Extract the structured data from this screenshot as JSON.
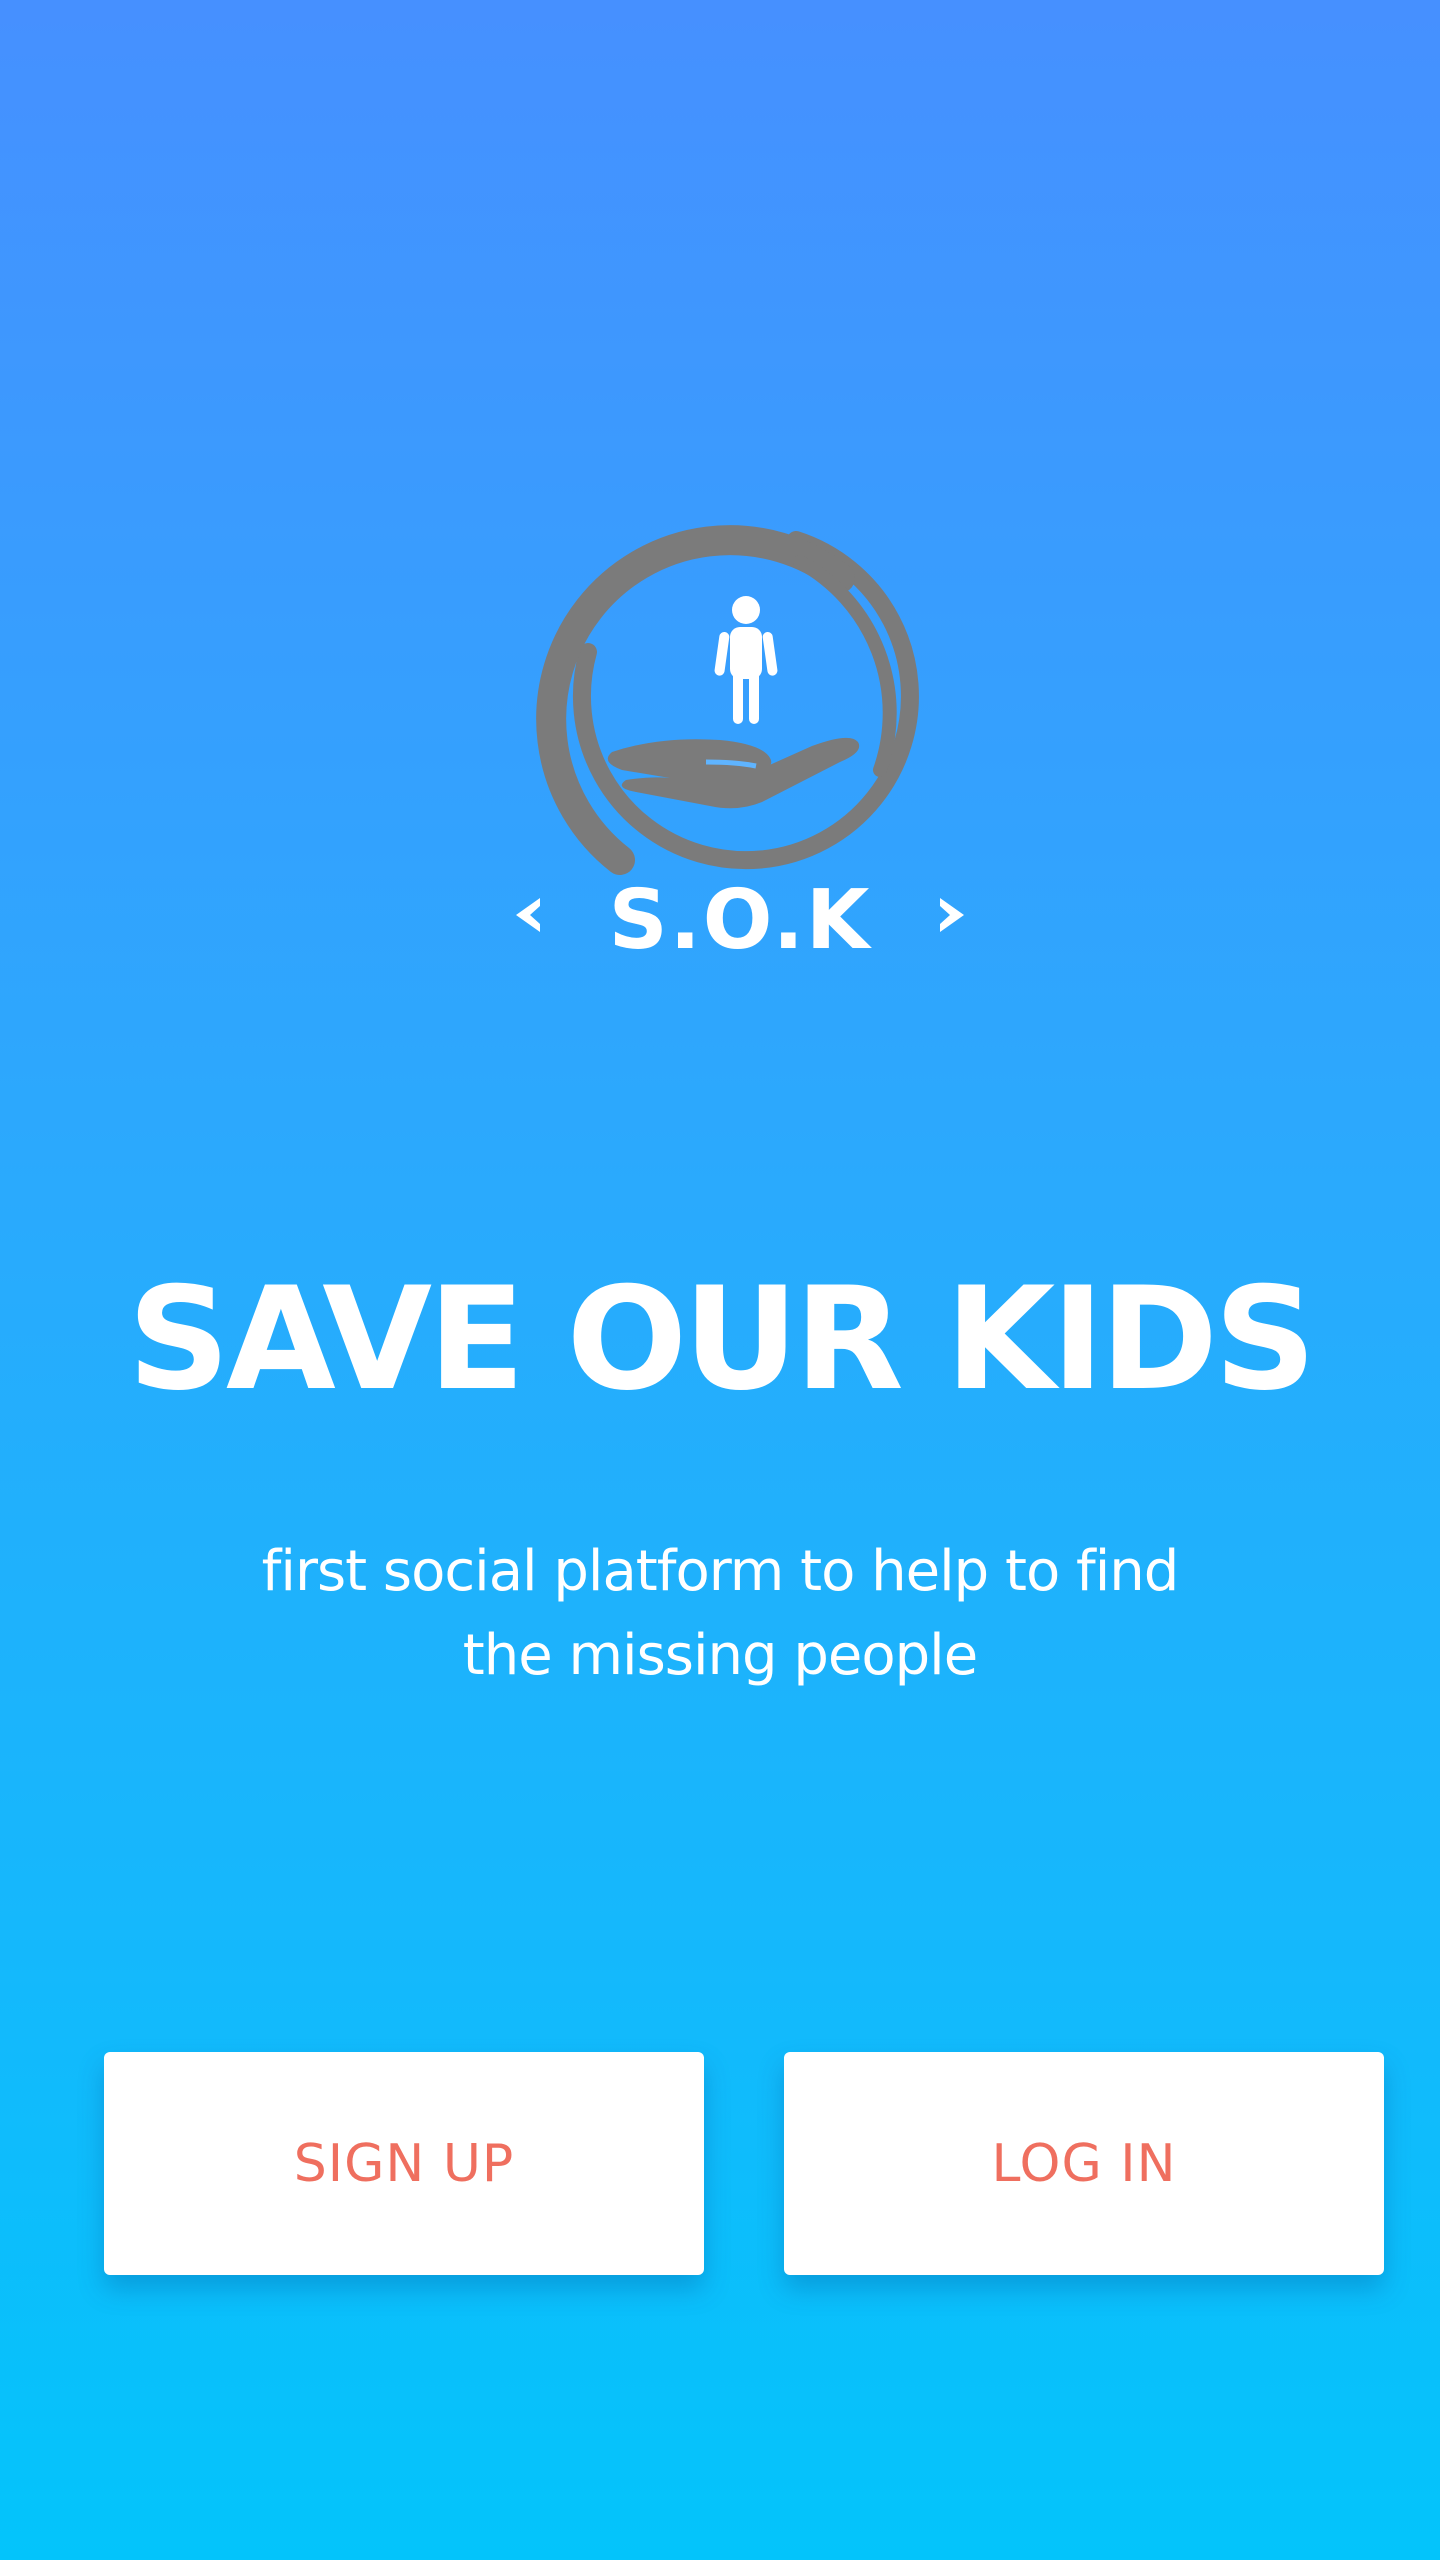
{
  "app": {
    "logo_text": "S.O.K",
    "title": "SAVE OUR KIDS",
    "subtitle": "first social platform to help to find the missing people"
  },
  "buttons": {
    "signup_label": "SIGN UP",
    "login_label": "LOG IN"
  },
  "colors": {
    "gradient_top": "#4690ff",
    "gradient_bottom": "#03c4fb",
    "button_text": "#ef6f5f",
    "logo_gray": "#7b7b7b"
  }
}
